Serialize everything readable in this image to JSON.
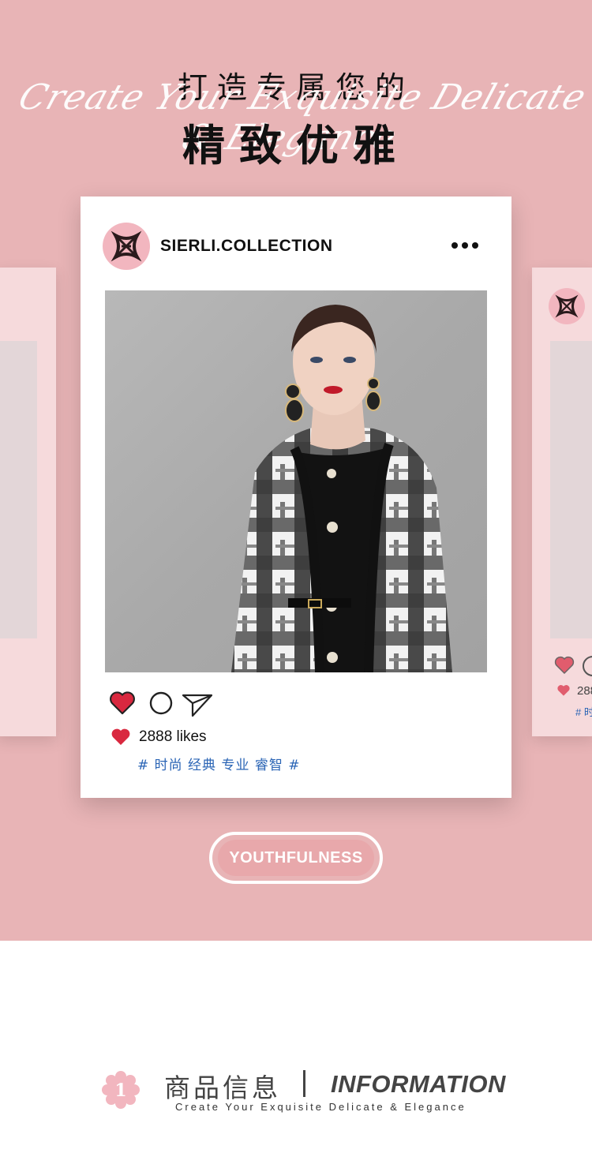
{
  "header": {
    "title_top": "打造专属您的",
    "script_text": "Create Your Exquisite Delicate & Elegance",
    "title_main": "精致优雅"
  },
  "post": {
    "username": "SIERLI.COLLECTION",
    "likes": "2888 likes",
    "tags": "# 时尚 经典 专业 睿智 #"
  },
  "side_right": {
    "likes_partial": "288",
    "tags_partial": "# 时"
  },
  "badge": {
    "label": "YOUTHFULNESS"
  },
  "footer": {
    "number": "1",
    "title_cn": "商品信息",
    "title_en": "INFORMATION",
    "subtitle": "Create Your Exquisite Delicate & Elegance"
  },
  "colors": {
    "background": "#e8b4b6",
    "heart": "#d9283f",
    "tag_blue": "#2a64b5",
    "accent_pink": "#f2b6bf"
  },
  "icons": {
    "more": "more-dots-icon",
    "like": "heart-icon",
    "comment": "comment-circle-icon",
    "share": "paper-plane-icon",
    "logo": "sierli-logo-icon"
  }
}
